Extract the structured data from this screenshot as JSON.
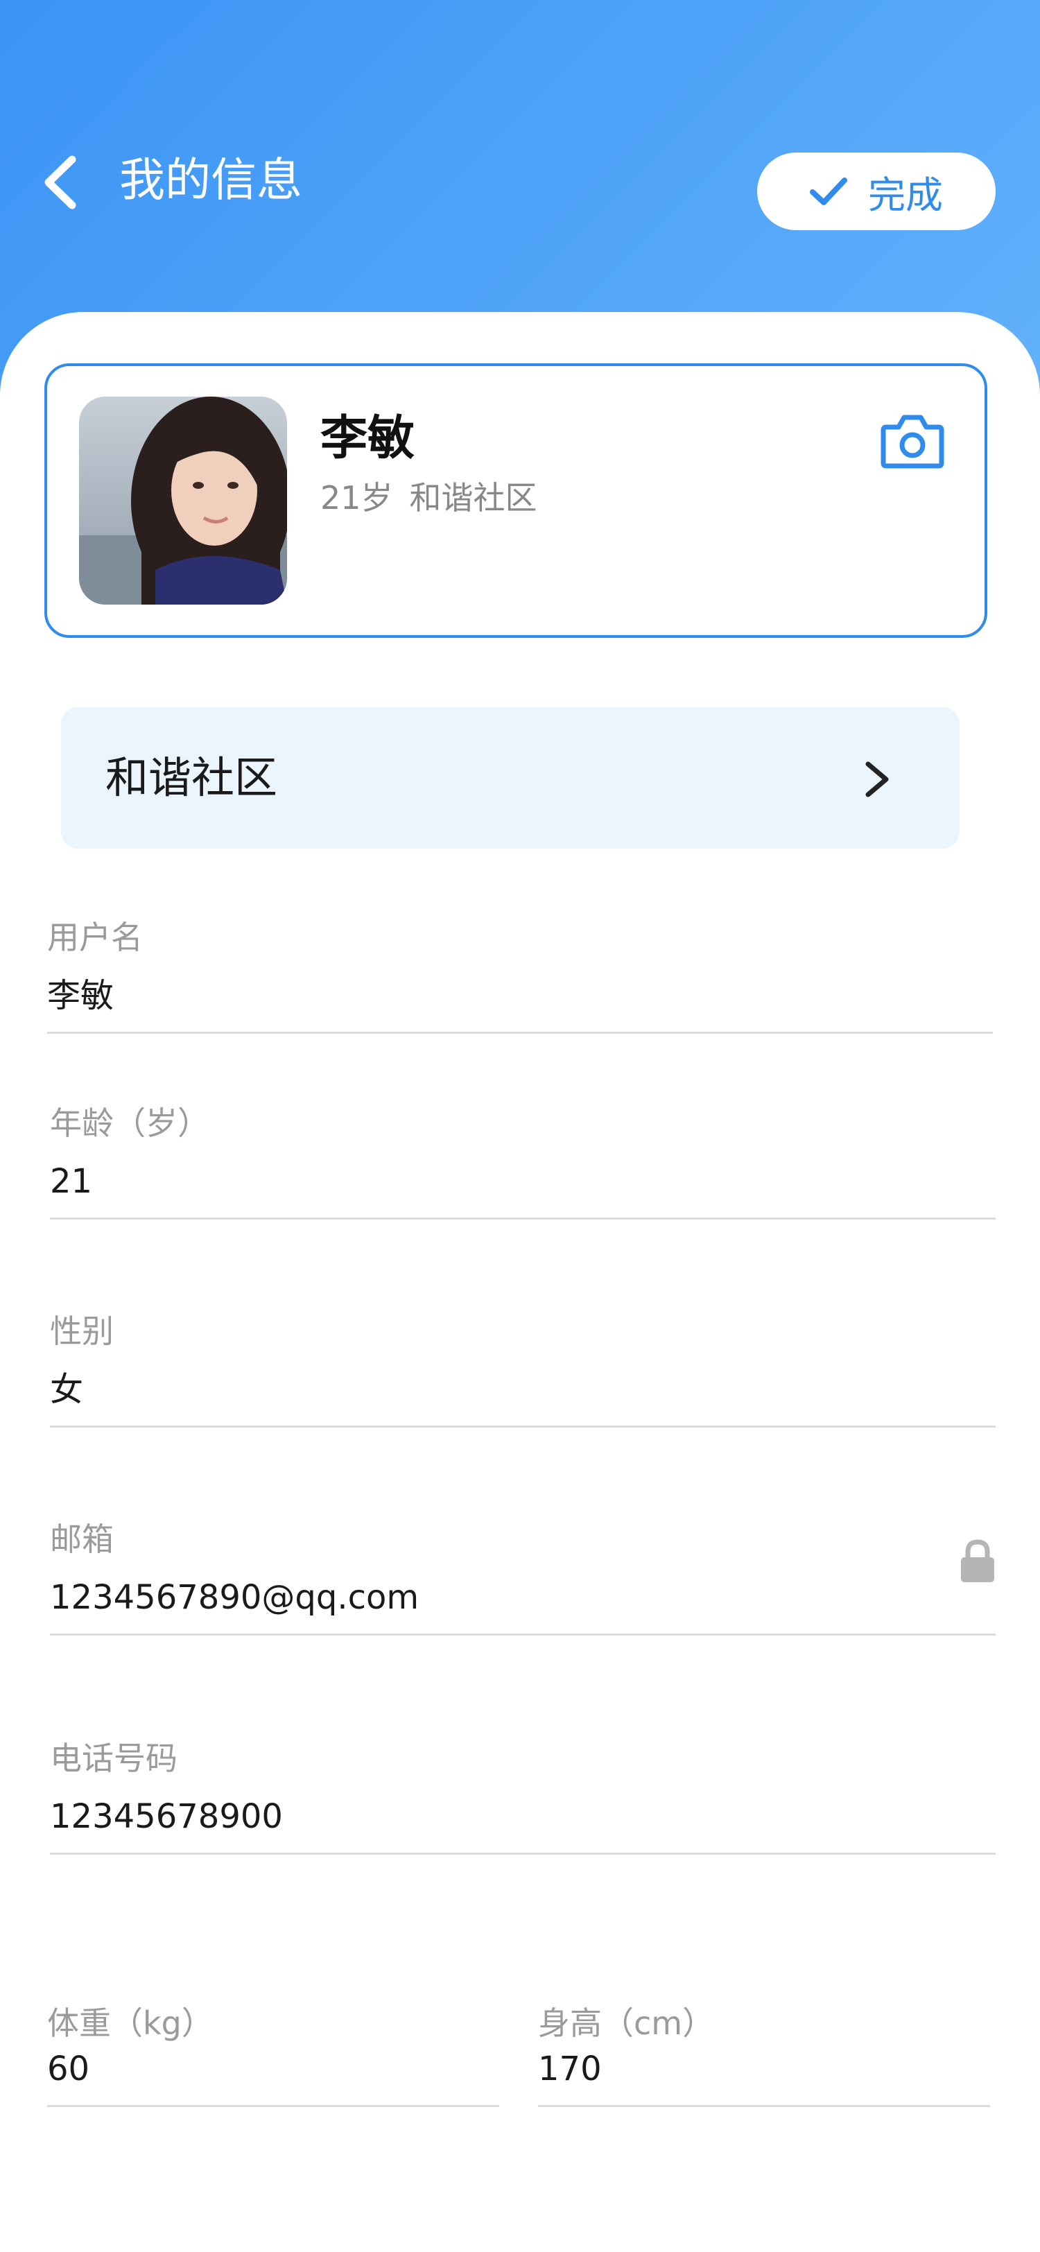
{
  "header": {
    "title": "我的信息",
    "done_label": "完成",
    "back_icon": "chevron-left-icon",
    "done_icon": "checkmark-icon",
    "gradient_start": "#3b94f5",
    "gradient_end": "#62b1fb"
  },
  "profile": {
    "name": "李敏",
    "age": "21岁",
    "community": "和谐社区",
    "camera_icon": "camera-icon",
    "accent": "#2f8cec"
  },
  "community_row": {
    "label": "和谐社区",
    "icon": "chevron-right-icon"
  },
  "form": {
    "username": {
      "label": "用户名",
      "value": "李敏"
    },
    "age": {
      "label": "年龄（岁）",
      "value": "21"
    },
    "gender": {
      "label": "性别",
      "value": "女"
    },
    "email": {
      "label": "邮箱",
      "value": "1234567890@qq.com",
      "icon": "lock-icon"
    },
    "phone": {
      "label": "电话号码",
      "value": "12345678900"
    },
    "weight": {
      "label": "体重（kg）",
      "value": "60"
    },
    "height": {
      "label": "身高（cm）",
      "value": "170"
    }
  }
}
